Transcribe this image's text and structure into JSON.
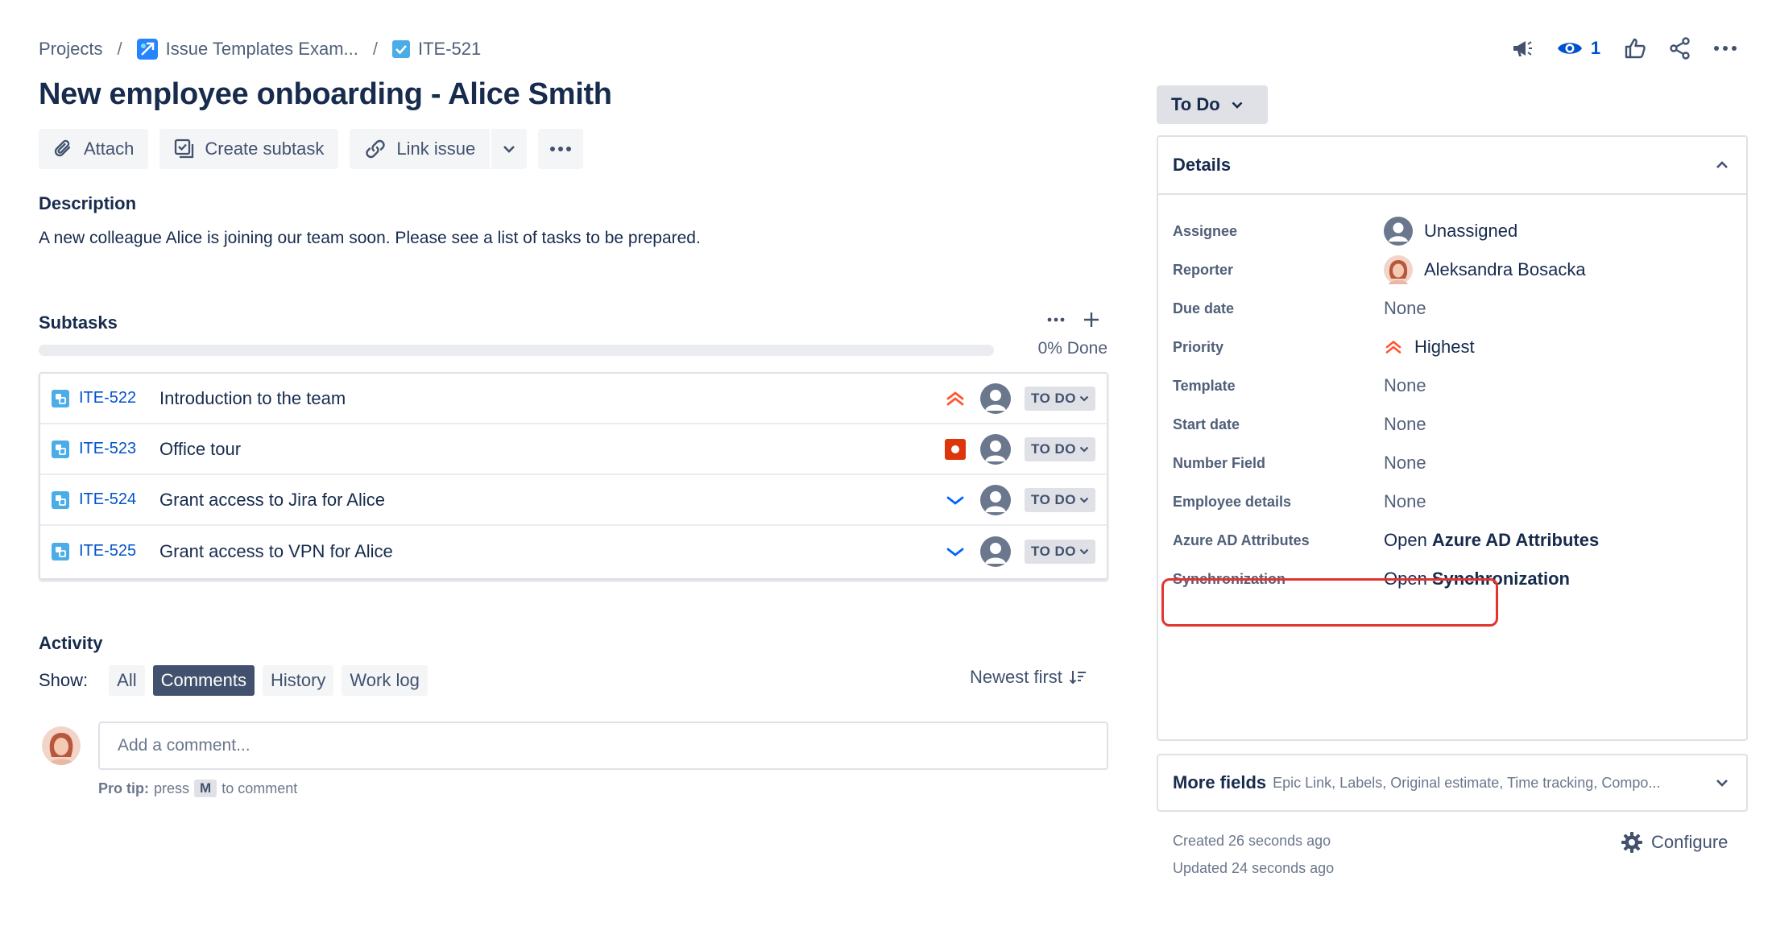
{
  "breadcrumb": {
    "projects": "Projects",
    "project_name": "Issue Templates Exam...",
    "issue_key": "ITE-521",
    "separator": "/"
  },
  "top_actions": {
    "watchers_count": "1"
  },
  "issue": {
    "title": "New employee onboarding - Alice Smith"
  },
  "toolbar": {
    "attach": "Attach",
    "create_subtask": "Create subtask",
    "link_issue": "Link issue"
  },
  "description": {
    "heading": "Description",
    "text": "A new colleague Alice is joining our team soon. Please see a list of tasks to be prepared."
  },
  "subtasks": {
    "heading": "Subtasks",
    "progress_fraction": 0,
    "done_label": "0% Done",
    "items": [
      {
        "key": "ITE-522",
        "summary": "Introduction to the team",
        "priority": "highest-icon",
        "status": "TO DO"
      },
      {
        "key": "ITE-523",
        "summary": "Office tour",
        "priority": "blocker-icon",
        "status": "TO DO"
      },
      {
        "key": "ITE-524",
        "summary": "Grant access to Jira for Alice",
        "priority": "low-icon",
        "status": "TO DO"
      },
      {
        "key": "ITE-525",
        "summary": "Grant access to VPN for Alice",
        "priority": "low-icon",
        "status": "TO DO"
      }
    ]
  },
  "activity": {
    "heading": "Activity",
    "show_label": "Show:",
    "filters": [
      "All",
      "Comments",
      "History",
      "Work log"
    ],
    "active_filter": "Comments",
    "sort_label": "Newest first",
    "comment_placeholder": "Add a comment...",
    "pro_tip_prefix": "Pro tip:",
    "pro_tip_press": "press",
    "pro_tip_key": "M",
    "pro_tip_suffix": "to comment"
  },
  "status_button": {
    "label": "To Do"
  },
  "details": {
    "heading": "Details",
    "fields": [
      {
        "label": "Assignee",
        "value": "Unassigned"
      },
      {
        "label": "Reporter",
        "value": "Aleksandra Bosacka"
      },
      {
        "label": "Due date",
        "value": "None"
      },
      {
        "label": "Priority",
        "value": "Highest"
      },
      {
        "label": "Template",
        "value": "None"
      },
      {
        "label": "Start date",
        "value": "None"
      },
      {
        "label": "Number Field",
        "value": "None"
      },
      {
        "label": "Employee details",
        "value": "None"
      },
      {
        "label": "Azure AD Attributes",
        "value_prefix": "Open",
        "value": "Azure AD Attributes"
      },
      {
        "label": "Synchronization",
        "value_prefix": "Open",
        "value": "Synchronization"
      }
    ]
  },
  "more_fields": {
    "label": "More fields",
    "summary": "Epic Link, Labels, Original estimate, Time tracking, Compo..."
  },
  "meta": {
    "created": "Created 26 seconds ago",
    "updated": "Updated 24 seconds ago",
    "configure": "Configure"
  },
  "colors": {
    "link": "#0052cc",
    "priority_highest": "#ff5630",
    "priority_low": "#0065ff",
    "blocker": "#de350b",
    "highlight": "#e3342f"
  }
}
